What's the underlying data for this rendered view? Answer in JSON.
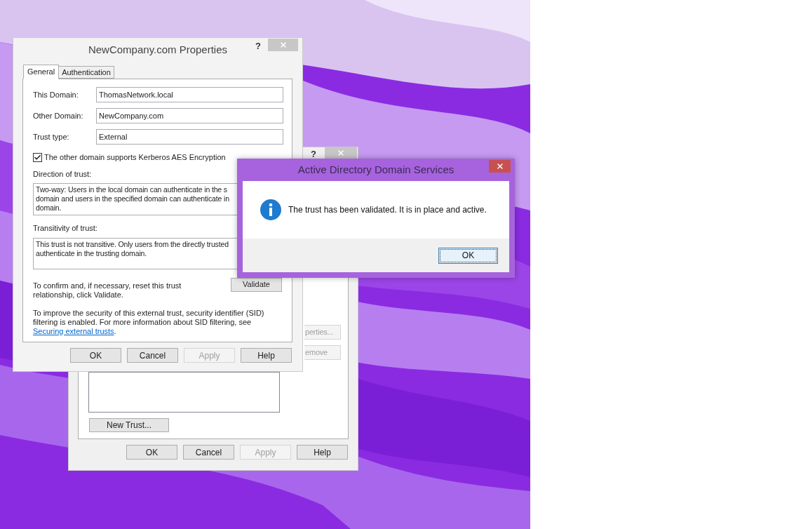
{
  "back_window": {
    "help": "?",
    "side_buttons": [
      {
        "label": "perties...",
        "disabled": true
      },
      {
        "label": "emove",
        "disabled": true
      }
    ],
    "new_trust_button": "New Trust...",
    "buttons": [
      {
        "label": "OK",
        "disabled": false
      },
      {
        "label": "Cancel",
        "disabled": false
      },
      {
        "label": "Apply",
        "disabled": true
      },
      {
        "label": "Help",
        "disabled": false
      }
    ]
  },
  "properties_window": {
    "title": "NewCompany.com Properties",
    "help": "?",
    "tabs": [
      {
        "label": "General",
        "selected": true
      },
      {
        "label": "Authentication",
        "selected": false
      }
    ],
    "fields": [
      {
        "label": "This Domain:",
        "value": "ThomasNetwork.local"
      },
      {
        "label": "Other Domain:",
        "value": "NewCompany.com"
      },
      {
        "label": "Trust type:",
        "value": "External"
      }
    ],
    "checkbox": {
      "label": "The other domain supports Kerberos AES Encryption",
      "checked": true
    },
    "direction": {
      "label": "Direction of trust:",
      "lines": [
        "Two-way: Users in the local domain can authenticate in the s",
        "domain and users in the specified domain can authenticate in",
        "domain."
      ]
    },
    "transitivity": {
      "label": "Transitivity of trust:",
      "lines": [
        "This trust is not transitive. Only users from the directly trusted",
        "authenticate in the trusting domain."
      ]
    },
    "validate": {
      "text": "To confirm and, if necessary, reset this trust relationship, click Validate.",
      "button": "Validate"
    },
    "sid_note": {
      "before": "To improve the security of this external trust, security identifier (SID) filtering is enabled. For more information about SID filtering, see",
      "link": "Securing external trusts",
      "after": "."
    },
    "buttons": [
      {
        "label": "OK",
        "disabled": false
      },
      {
        "label": "Cancel",
        "disabled": false
      },
      {
        "label": "Apply",
        "disabled": true
      },
      {
        "label": "Help",
        "disabled": false
      }
    ]
  },
  "message_box": {
    "title": "Active Directory Domain Services",
    "message": "The trust has been validated. It is in place and active.",
    "button": "OK"
  }
}
